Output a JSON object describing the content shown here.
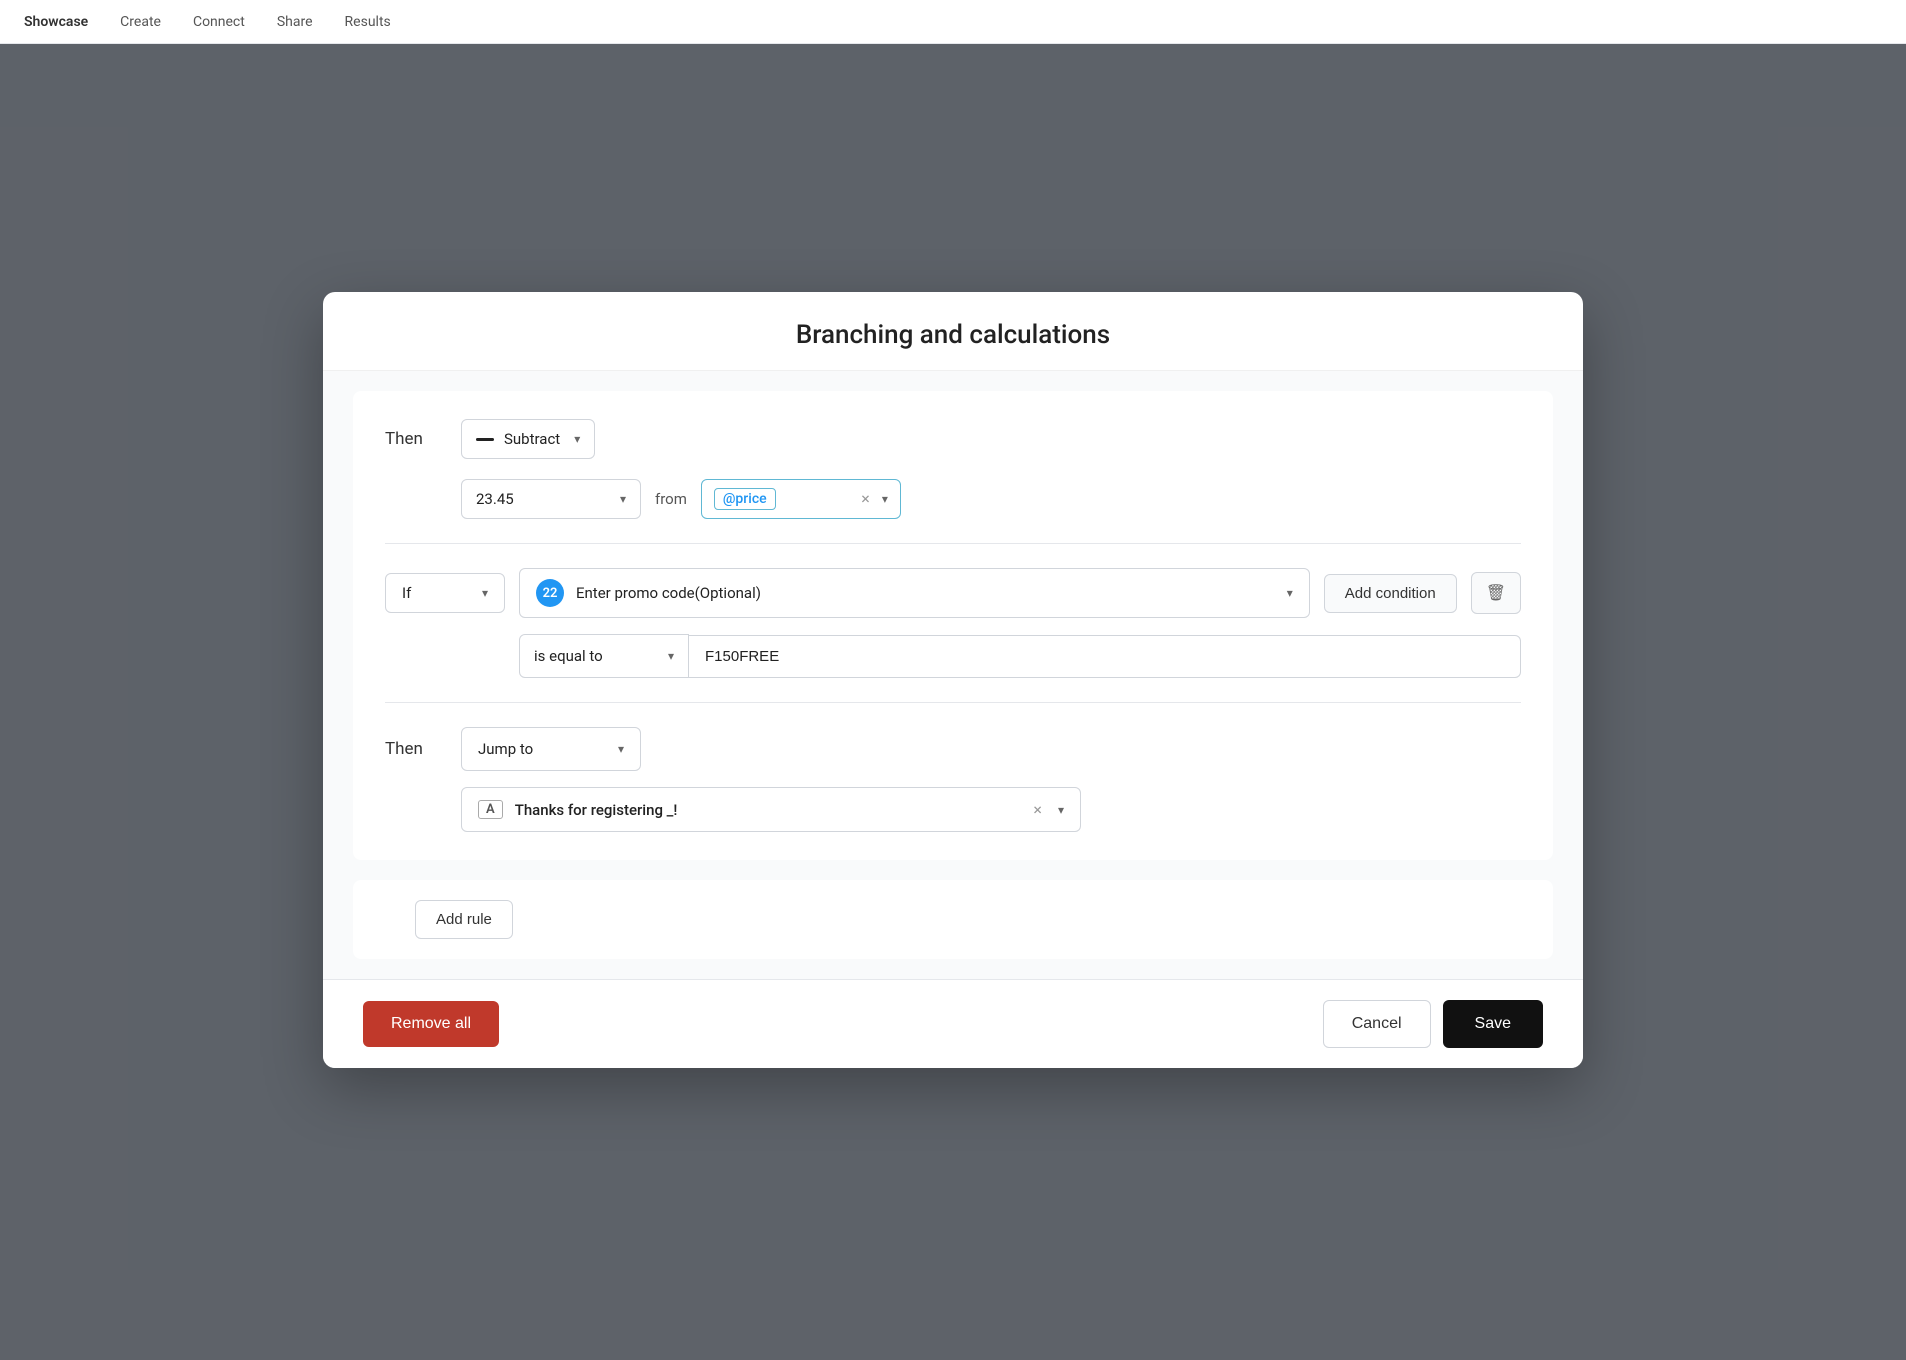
{
  "page": {
    "bg_nav": {
      "brand": "Showcase",
      "items": [
        "Create",
        "Connect",
        "Share",
        "Results"
      ]
    }
  },
  "modal": {
    "title": "Branching and calculations",
    "then_section": {
      "then_label": "Then",
      "action_label": "Subtract",
      "value": "23.45",
      "from_text": "from",
      "tag_label": "@price"
    },
    "if_section": {
      "if_label": "If",
      "question_number": "22",
      "question_text": "Enter promo code(Optional)",
      "add_condition_label": "Add condition",
      "condition": {
        "operator": "is equal to",
        "value": "F150FREE"
      }
    },
    "then_jump_section": {
      "then_label": "Then",
      "action_label": "Jump to",
      "target_prefix": "A",
      "target_text": "Thanks for registering _!"
    },
    "add_rule_label": "Add rule",
    "footer": {
      "remove_all_label": "Remove all",
      "cancel_label": "Cancel",
      "save_label": "Save"
    }
  }
}
